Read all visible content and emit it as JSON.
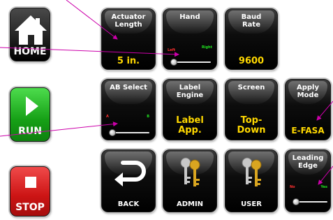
{
  "colors": {
    "home": "#111111",
    "run": "#1fb31f",
    "stop": "#d21a1a",
    "tile": "#000000",
    "value": "#ffd800",
    "callout": "#cc00aa"
  },
  "side": {
    "home": {
      "label": "HOME",
      "icon": "house-icon"
    },
    "run": {
      "label": "RUN",
      "icon": "play-icon"
    },
    "stop": {
      "label": "STOP",
      "icon": "stop-square-icon"
    }
  },
  "tiles": {
    "actuator_length": {
      "title": "Actuator\nLength",
      "value": "5 in."
    },
    "hand": {
      "title": "Hand",
      "left": "Left",
      "right": "Right",
      "switch_position": "left"
    },
    "baud_rate": {
      "title": "Baud\nRate",
      "value": "9600"
    },
    "ab_select": {
      "title": "AB Select",
      "left": "A",
      "right": "B",
      "switch_position": "left"
    },
    "label_engine": {
      "title": "Label\nEngine",
      "value": "Label\nApp."
    },
    "screen": {
      "title": "Screen",
      "value": "Top-\nDown"
    },
    "apply_mode": {
      "title": "Apply\nMode",
      "value": "E-FASA"
    },
    "back": {
      "label": "BACK",
      "icon": "back-arrow-icon"
    },
    "admin": {
      "label": "ADMIN",
      "icon": "keys-icon"
    },
    "user": {
      "label": "USER",
      "icon": "keys-icon"
    },
    "leading_edge": {
      "title": "Leading\nEdge",
      "left": "No",
      "right": "Yes",
      "switch_position": "left"
    }
  }
}
